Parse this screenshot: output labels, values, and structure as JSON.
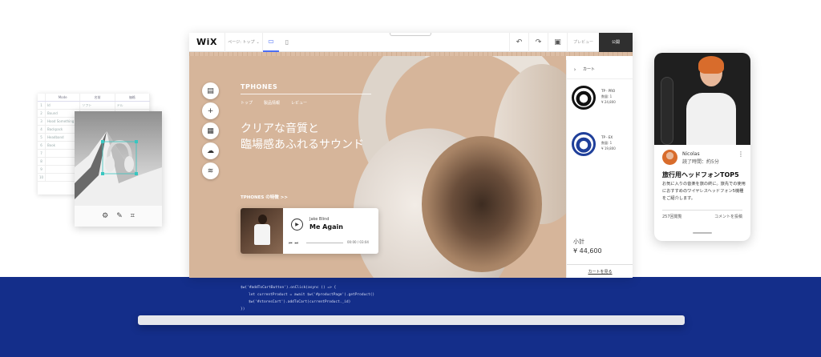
{
  "spreadsheet": {
    "headers": [
      "",
      "Mode",
      "名前",
      "価格"
    ],
    "rows": [
      [
        "1",
        "Id",
        "ソフト",
        "ドル"
      ],
      [
        "2",
        "Bound",
        "",
        ""
      ],
      [
        "3",
        "Hood Something",
        "",
        ""
      ],
      [
        "4",
        "Backpack",
        "",
        ""
      ],
      [
        "5",
        "Headband",
        "",
        ""
      ],
      [
        "6",
        "Book",
        "",
        ""
      ],
      [
        "7",
        "",
        "",
        ""
      ],
      [
        "8",
        "",
        "",
        ""
      ],
      [
        "9",
        "",
        "",
        ""
      ],
      [
        "10",
        "",
        "",
        ""
      ]
    ]
  },
  "photo_editor": {
    "tools": [
      "gear-icon",
      "pen-icon",
      "crop-icon"
    ]
  },
  "editor": {
    "logo": "WiX",
    "page_selector": "ページ: トップ",
    "preview_label": "プレビュー",
    "publish_label": "公開"
  },
  "site": {
    "brand": "TPHONES",
    "nav": [
      "トップ",
      "製品情報",
      "レビュー"
    ],
    "hero_line1": "クリアな音質と",
    "hero_line2": "臨場感あふれるサウンド",
    "features_link": "TPHONES の特徴 >>",
    "player": {
      "artist": "Jake Blind",
      "song": "Me Again",
      "time": "00:00 / 03:04",
      "progress": 0
    }
  },
  "cart": {
    "title": "カート",
    "items": [
      {
        "name": "TP - PRO",
        "qty": "数量: 1",
        "price": "¥ 24,800",
        "color": "#111111"
      },
      {
        "name": "TP - EX",
        "qty": "数量: 1",
        "price": "¥ 19,800",
        "color": "#1f3f9a"
      }
    ],
    "subtotal_label": "小計",
    "subtotal": "¥ 44,600",
    "view_cart": "カートを見る"
  },
  "code": {
    "line1": "$w('#addToCartButton').onClick(async () => {",
    "line2": "let currentProduct = await $w('#productPage').getProduct()",
    "line3": "$w('#storesCart').addToCart(currentProduct._id)",
    "line4": "})"
  },
  "phone": {
    "author": "Nicolas",
    "readtime": "読了時間：約5分",
    "post_title": "旅行用ヘッドフォンTOP5",
    "post_body": "お気に入りの音楽を旅の終に。旅先での使用におすすめのワイヤレスヘッドフォン5機種をご紹介します。",
    "views": "257回閲覧",
    "comment": "コメントを投稿"
  },
  "colors": {
    "navy": "#142e8a",
    "canvas_tan": "#d6b59a",
    "accent_blue": "#4a6ef5"
  }
}
